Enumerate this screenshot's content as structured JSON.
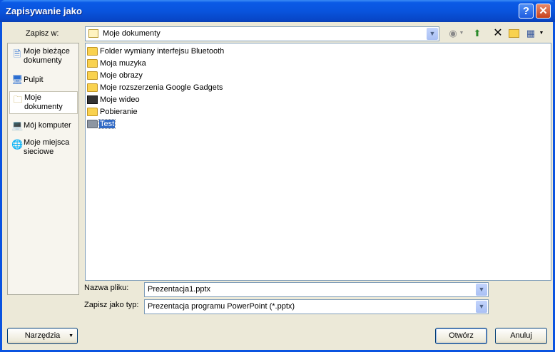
{
  "window": {
    "title": "Zapisywanie jako"
  },
  "save_in": {
    "label": "Zapisz w:",
    "value": "Moje dokumenty"
  },
  "places": [
    {
      "label": "Moje bieżące\ndokumenty",
      "icon": "recent-documents-icon"
    },
    {
      "label": "Pulpit",
      "icon": "desktop-icon"
    },
    {
      "label": "Moje\ndokumenty",
      "icon": "my-documents-icon"
    },
    {
      "label": "Mój komputer",
      "icon": "my-computer-icon"
    },
    {
      "label": "Moje miejsca\nsieciowe",
      "icon": "network-places-icon"
    }
  ],
  "files": [
    {
      "name": "Folder wymiany interfejsu Bluetooth"
    },
    {
      "name": "Moja muzyka"
    },
    {
      "name": "Moje obrazy"
    },
    {
      "name": "Moje rozszerzenia Google Gadgets"
    },
    {
      "name": "Moje wideo"
    },
    {
      "name": "Pobieranie"
    },
    {
      "name": "Test"
    }
  ],
  "filename": {
    "label": "Nazwa pliku:",
    "value": "Prezentacja1.pptx"
  },
  "filetype": {
    "label": "Zapisz jako typ:",
    "value": "Prezentacja programu PowerPoint (*.pptx)"
  },
  "buttons": {
    "tools": "Narzędzia",
    "open": "Otwórz",
    "cancel": "Anuluj"
  },
  "colors": {
    "title_bar": "#0a53e0",
    "selection": "#316ac5",
    "folder": "#f9d24f"
  }
}
